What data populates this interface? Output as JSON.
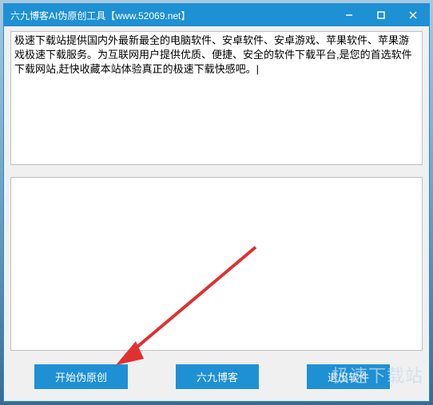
{
  "titlebar": {
    "title": "六九博客AI伪原创工具【www.52069.net】"
  },
  "input": {
    "text": "极速下载站提供国内外最新最全的电脑软件、安卓软件、安卓游戏、苹果软件、苹果游戏极速下载服务。为互联网用户提供优质、便捷、安全的软件下载平台,是您的首选软件下载网站,赶快收藏本站体验真正的极速下载快感吧。|"
  },
  "output": {
    "text": ""
  },
  "buttons": {
    "start": "开始伪原创",
    "blog": "六九博客",
    "exit": "退出软件"
  },
  "watermark": "极速下载站"
}
